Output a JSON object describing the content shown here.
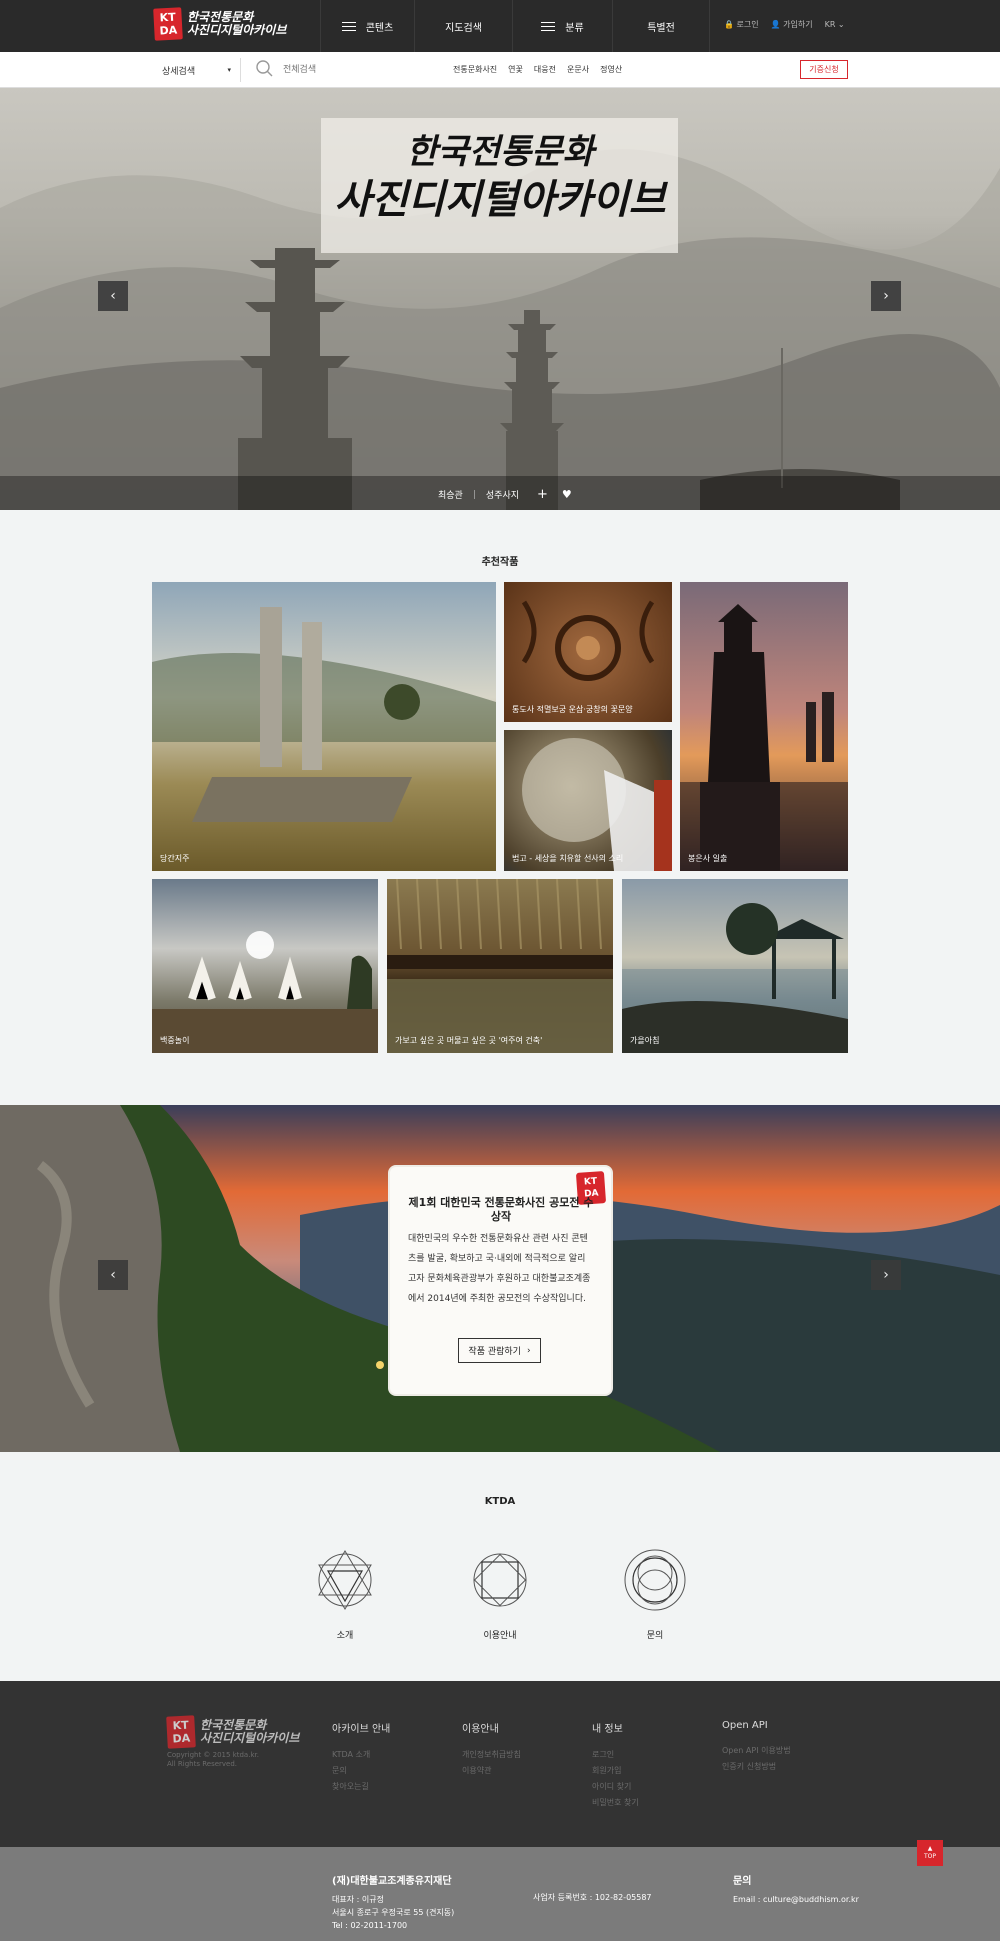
{
  "header": {
    "logo_badge": "KT DA",
    "logo_text_1": "한국전통문화",
    "logo_text_2": "사진디지털아카이브",
    "nav": [
      {
        "label": "콘텐츠"
      },
      {
        "label": "지도검색"
      },
      {
        "label": "분류"
      },
      {
        "label": "특별전"
      }
    ],
    "login": "로그인",
    "join": "가입하기",
    "lang": "KR"
  },
  "searchbar": {
    "advanced_label": "상세검색",
    "placeholder": "전체검색",
    "quick_links": [
      "전통문화사진",
      "연꽃",
      "대웅전",
      "운문사",
      "정영산"
    ],
    "donate_label": "기증신청"
  },
  "hero": {
    "title_line1": "한국전통문화",
    "title_line2": "사진디지털아카이브",
    "caption_author": "최승관",
    "caption_place": "성주사지",
    "prev_icon": "chevron-left-icon",
    "next_icon": "chevron-right-icon"
  },
  "recommended": {
    "title": "추천작품",
    "items": [
      {
        "label": "당간지주"
      },
      {
        "label": "통도사 적멸보궁 운삼·궁창의 꽃문양"
      },
      {
        "label": "법고 - 세상을 치유할 선사의 소리"
      },
      {
        "label": "봉은사 일출"
      },
      {
        "label": "백중놀이"
      },
      {
        "label": "가보고 싶은 곳 머물고 싶은 곳 '여주여 건축'"
      },
      {
        "label": "가을아침"
      }
    ]
  },
  "contest": {
    "stamp": "KT DA",
    "title": "제1회 대한민국 전통문화사진 공모전 수상작",
    "body": "대한민국의 우수한 전통문화유산 관련 사진 콘텐츠를 발굴, 확보하고 국·내외에 적극적으로 알리고자 문화체육관광부가 후원하고 대한불교조계종에서 2014년에 주최한 공모전의 수상작입니다.",
    "button": "작품 관람하기"
  },
  "ktda": {
    "title": "KTDA",
    "items": [
      {
        "label": "소개"
      },
      {
        "label": "이용안내"
      },
      {
        "label": "문의"
      }
    ]
  },
  "footer": {
    "copyright_1": "Copyright © 2015 ktda.kr.",
    "copyright_2": "All Rights Reserved.",
    "columns": [
      {
        "title": "아카이브 안내",
        "items": [
          "KTDA 소개",
          "문의",
          "찾아오는길"
        ]
      },
      {
        "title": "이용안내",
        "items": [
          "개인정보취급방침",
          "이용약관"
        ]
      },
      {
        "title": "내 정보",
        "items": [
          "로그인",
          "회원가입",
          "아이디 찾기",
          "비밀번호 찾기"
        ]
      },
      {
        "title": "Open API",
        "items": [
          "Open API 이용방법",
          "인증키 신청방법"
        ]
      }
    ],
    "org_name": "(재)대한불교조계종유지재단",
    "rep": "대표자 : 이규정",
    "address": "서울시 종로구 우정국로 55 (견지동)",
    "tel": "Tel : 02-2011-1700",
    "biz_no": "사업자 등록번호 : 102-82-05587",
    "contact_title": "문의",
    "contact_email": "Email : culture@buddhism.or.kr",
    "top_label": "TOP"
  }
}
